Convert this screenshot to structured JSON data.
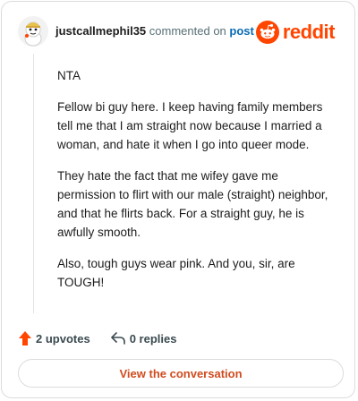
{
  "header": {
    "username": "justcallmephil35",
    "commented_text": "commented on",
    "post_link": "post",
    "brand": "reddit"
  },
  "comment": {
    "paragraphs": [
      "NTA",
      "Fellow bi guy here. I keep having family members tell me that I am straight now because I married a woman, and hate it when I go into queer mode.",
      "They hate the fact that me wifey gave me permission to flirt with our male (straight) neighbor, and that he flirts back. For a straight guy, he is awfully smooth.",
      "Also, tough guys wear pink. And you, sir, are TOUGH!"
    ]
  },
  "actions": {
    "upvotes": "2 upvotes",
    "replies": "0 replies"
  },
  "footer": {
    "view_button": "View the conversation"
  },
  "colors": {
    "brand": "#ff4500",
    "link": "#0a6bb3",
    "button_text": "#d14b1f"
  },
  "icons": [
    "avatar",
    "reddit-logo-icon",
    "upvote-arrow-icon",
    "reply-arrow-icon"
  ]
}
